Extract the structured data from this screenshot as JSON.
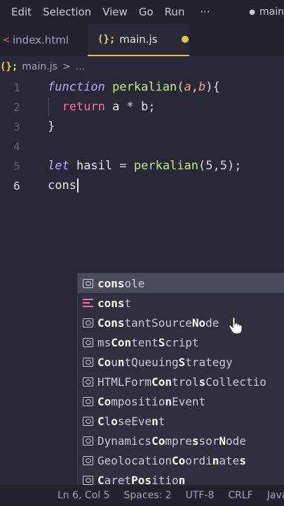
{
  "menu": {
    "items": [
      "Edit",
      "Selection",
      "View",
      "Go",
      "Run"
    ],
    "more": "···",
    "branch": "main"
  },
  "tabs": [
    {
      "label": "index.html",
      "icon": "html-file-icon",
      "active": false
    },
    {
      "label": "main.js",
      "icon": "js-file-icon",
      "active": true,
      "modified": true
    }
  ],
  "breadcrumb": {
    "file": "main.js",
    "separator": ">",
    "symbol": "..."
  },
  "editor": {
    "lines": [
      {
        "number": "1",
        "tokens": [
          [
            "kw-fn",
            "function"
          ],
          [
            "punc",
            " "
          ],
          [
            "fn",
            "perkalian"
          ],
          [
            "punc",
            "("
          ],
          [
            "param",
            "a"
          ],
          [
            "punc",
            ","
          ],
          [
            "param",
            "b"
          ],
          [
            "punc",
            "){"
          ]
        ]
      },
      {
        "number": "2",
        "tokens": [
          [
            "punc",
            "  "
          ],
          [
            "kw-ret",
            "return"
          ],
          [
            "var",
            " a "
          ],
          [
            "op",
            "*"
          ],
          [
            "var",
            " b"
          ],
          [
            "punc",
            ";"
          ]
        ]
      },
      {
        "number": "3",
        "tokens": [
          [
            "punc",
            "}"
          ]
        ]
      },
      {
        "number": "4",
        "tokens": []
      },
      {
        "number": "5",
        "tokens": [
          [
            "kw-let",
            "let"
          ],
          [
            "var",
            " hasil "
          ],
          [
            "op",
            "="
          ],
          [
            "punc",
            " "
          ],
          [
            "fn",
            "perkalian"
          ],
          [
            "punc",
            "("
          ],
          [
            "num",
            "5"
          ],
          [
            "punc",
            ","
          ],
          [
            "num",
            "5"
          ],
          [
            "punc",
            ");"
          ]
        ]
      },
      {
        "number": "6",
        "tokens": [
          [
            "var",
            "cons"
          ]
        ],
        "active": true
      }
    ]
  },
  "suggestions": [
    {
      "parts": [
        [
          "b",
          "cons"
        ],
        [
          "",
          "ole"
        ]
      ],
      "kind": "variable",
      "selected": true
    },
    {
      "parts": [
        [
          "b",
          "cons"
        ],
        [
          "",
          "t"
        ]
      ],
      "kind": "keyword"
    },
    {
      "parts": [
        [
          "b",
          "Cons"
        ],
        [
          "",
          "tantSource"
        ],
        [
          "b",
          "No"
        ],
        [
          "",
          "de"
        ]
      ],
      "kind": "variable"
    },
    {
      "parts": [
        [
          "",
          "ms"
        ],
        [
          "b",
          "Con"
        ],
        [
          "",
          "tent"
        ],
        [
          "b",
          "S"
        ],
        [
          "",
          "cript"
        ]
      ],
      "kind": "variable"
    },
    {
      "parts": [
        [
          "b",
          "Co"
        ],
        [
          "",
          "u"
        ],
        [
          "b",
          "n"
        ],
        [
          "",
          "tQueuing"
        ],
        [
          "b",
          "S"
        ],
        [
          "",
          "trategy"
        ]
      ],
      "kind": "variable"
    },
    {
      "parts": [
        [
          "",
          "HTMLForm"
        ],
        [
          "b",
          "Con"
        ],
        [
          "",
          "trol"
        ],
        [
          "b",
          "s"
        ],
        [
          "",
          "Collectio"
        ]
      ],
      "kind": "variable"
    },
    {
      "parts": [
        [
          "b",
          "Co"
        ],
        [
          "",
          "mpositio"
        ],
        [
          "b",
          "n"
        ],
        [
          "",
          "Event"
        ]
      ],
      "kind": "variable"
    },
    {
      "parts": [
        [
          "b",
          "C"
        ],
        [
          "",
          "l"
        ],
        [
          "b",
          "o"
        ],
        [
          "",
          "seEve"
        ],
        [
          "b",
          "n"
        ],
        [
          "",
          "t"
        ]
      ],
      "kind": "variable"
    },
    {
      "parts": [
        [
          "",
          "Dynamics"
        ],
        [
          "b",
          "Co"
        ],
        [
          "",
          "mpre"
        ],
        [
          "b",
          "s"
        ],
        [
          "",
          "sor"
        ],
        [
          "b",
          "N"
        ],
        [
          "",
          "ode"
        ]
      ],
      "kind": "variable"
    },
    {
      "parts": [
        [
          "",
          "Geolocation"
        ],
        [
          "b",
          "Co"
        ],
        [
          "",
          "ordi"
        ],
        [
          "b",
          "n"
        ],
        [
          "",
          "ate"
        ],
        [
          "b",
          "s"
        ]
      ],
      "kind": "variable"
    },
    {
      "parts": [
        [
          "b",
          "C"
        ],
        [
          "",
          "aret"
        ],
        [
          "b",
          "Pos"
        ],
        [
          "",
          "itio"
        ],
        [
          "b",
          "n"
        ]
      ],
      "kind": "variable"
    }
  ],
  "status": {
    "position": "Ln 6, Col 5",
    "spaces": "Spaces: 2",
    "encoding": "UTF-8",
    "eol": "CRLF",
    "language": "JavaScript"
  }
}
